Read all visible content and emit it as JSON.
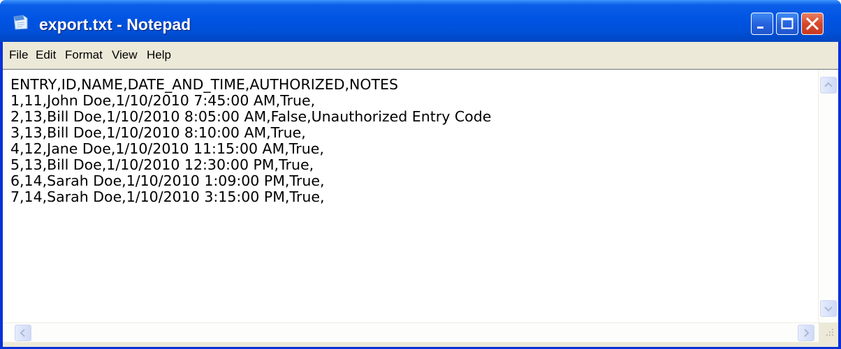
{
  "window": {
    "title": "export.txt - Notepad",
    "colors": {
      "titlebar": "#0054e3",
      "close_button": "#d6482c",
      "menubar": "#ece9d8"
    }
  },
  "titlebar": {
    "app_icon": "notepad-icon",
    "buttons": [
      {
        "name": "minimize",
        "icon": "minimize-icon"
      },
      {
        "name": "maximize",
        "icon": "maximize-icon"
      },
      {
        "name": "close",
        "icon": "close-icon"
      }
    ]
  },
  "menubar": {
    "items": [
      {
        "label": "File"
      },
      {
        "label": "Edit"
      },
      {
        "label": "Format"
      },
      {
        "label": "View"
      },
      {
        "label": "Help"
      }
    ]
  },
  "editor": {
    "lines": [
      "ENTRY,ID,NAME,DATE_AND_TIME,AUTHORIZED,NOTES",
      "1,11,John Doe,1/10/2010 7:45:00 AM,True,",
      "2,13,Bill Doe,1/10/2010 8:05:00 AM,False,Unauthorized Entry Code",
      "3,13,Bill Doe,1/10/2010 8:10:00 AM,True,",
      "4,12,Jane Doe,1/10/2010 11:15:00 AM,True,",
      "5,13,Bill Doe,1/10/2010 12:30:00 PM,True,",
      "6,14,Sarah Doe,1/10/2010 1:09:00 PM,True,",
      "7,14,Sarah Doe,1/10/2010 3:15:00 PM,True,"
    ]
  }
}
